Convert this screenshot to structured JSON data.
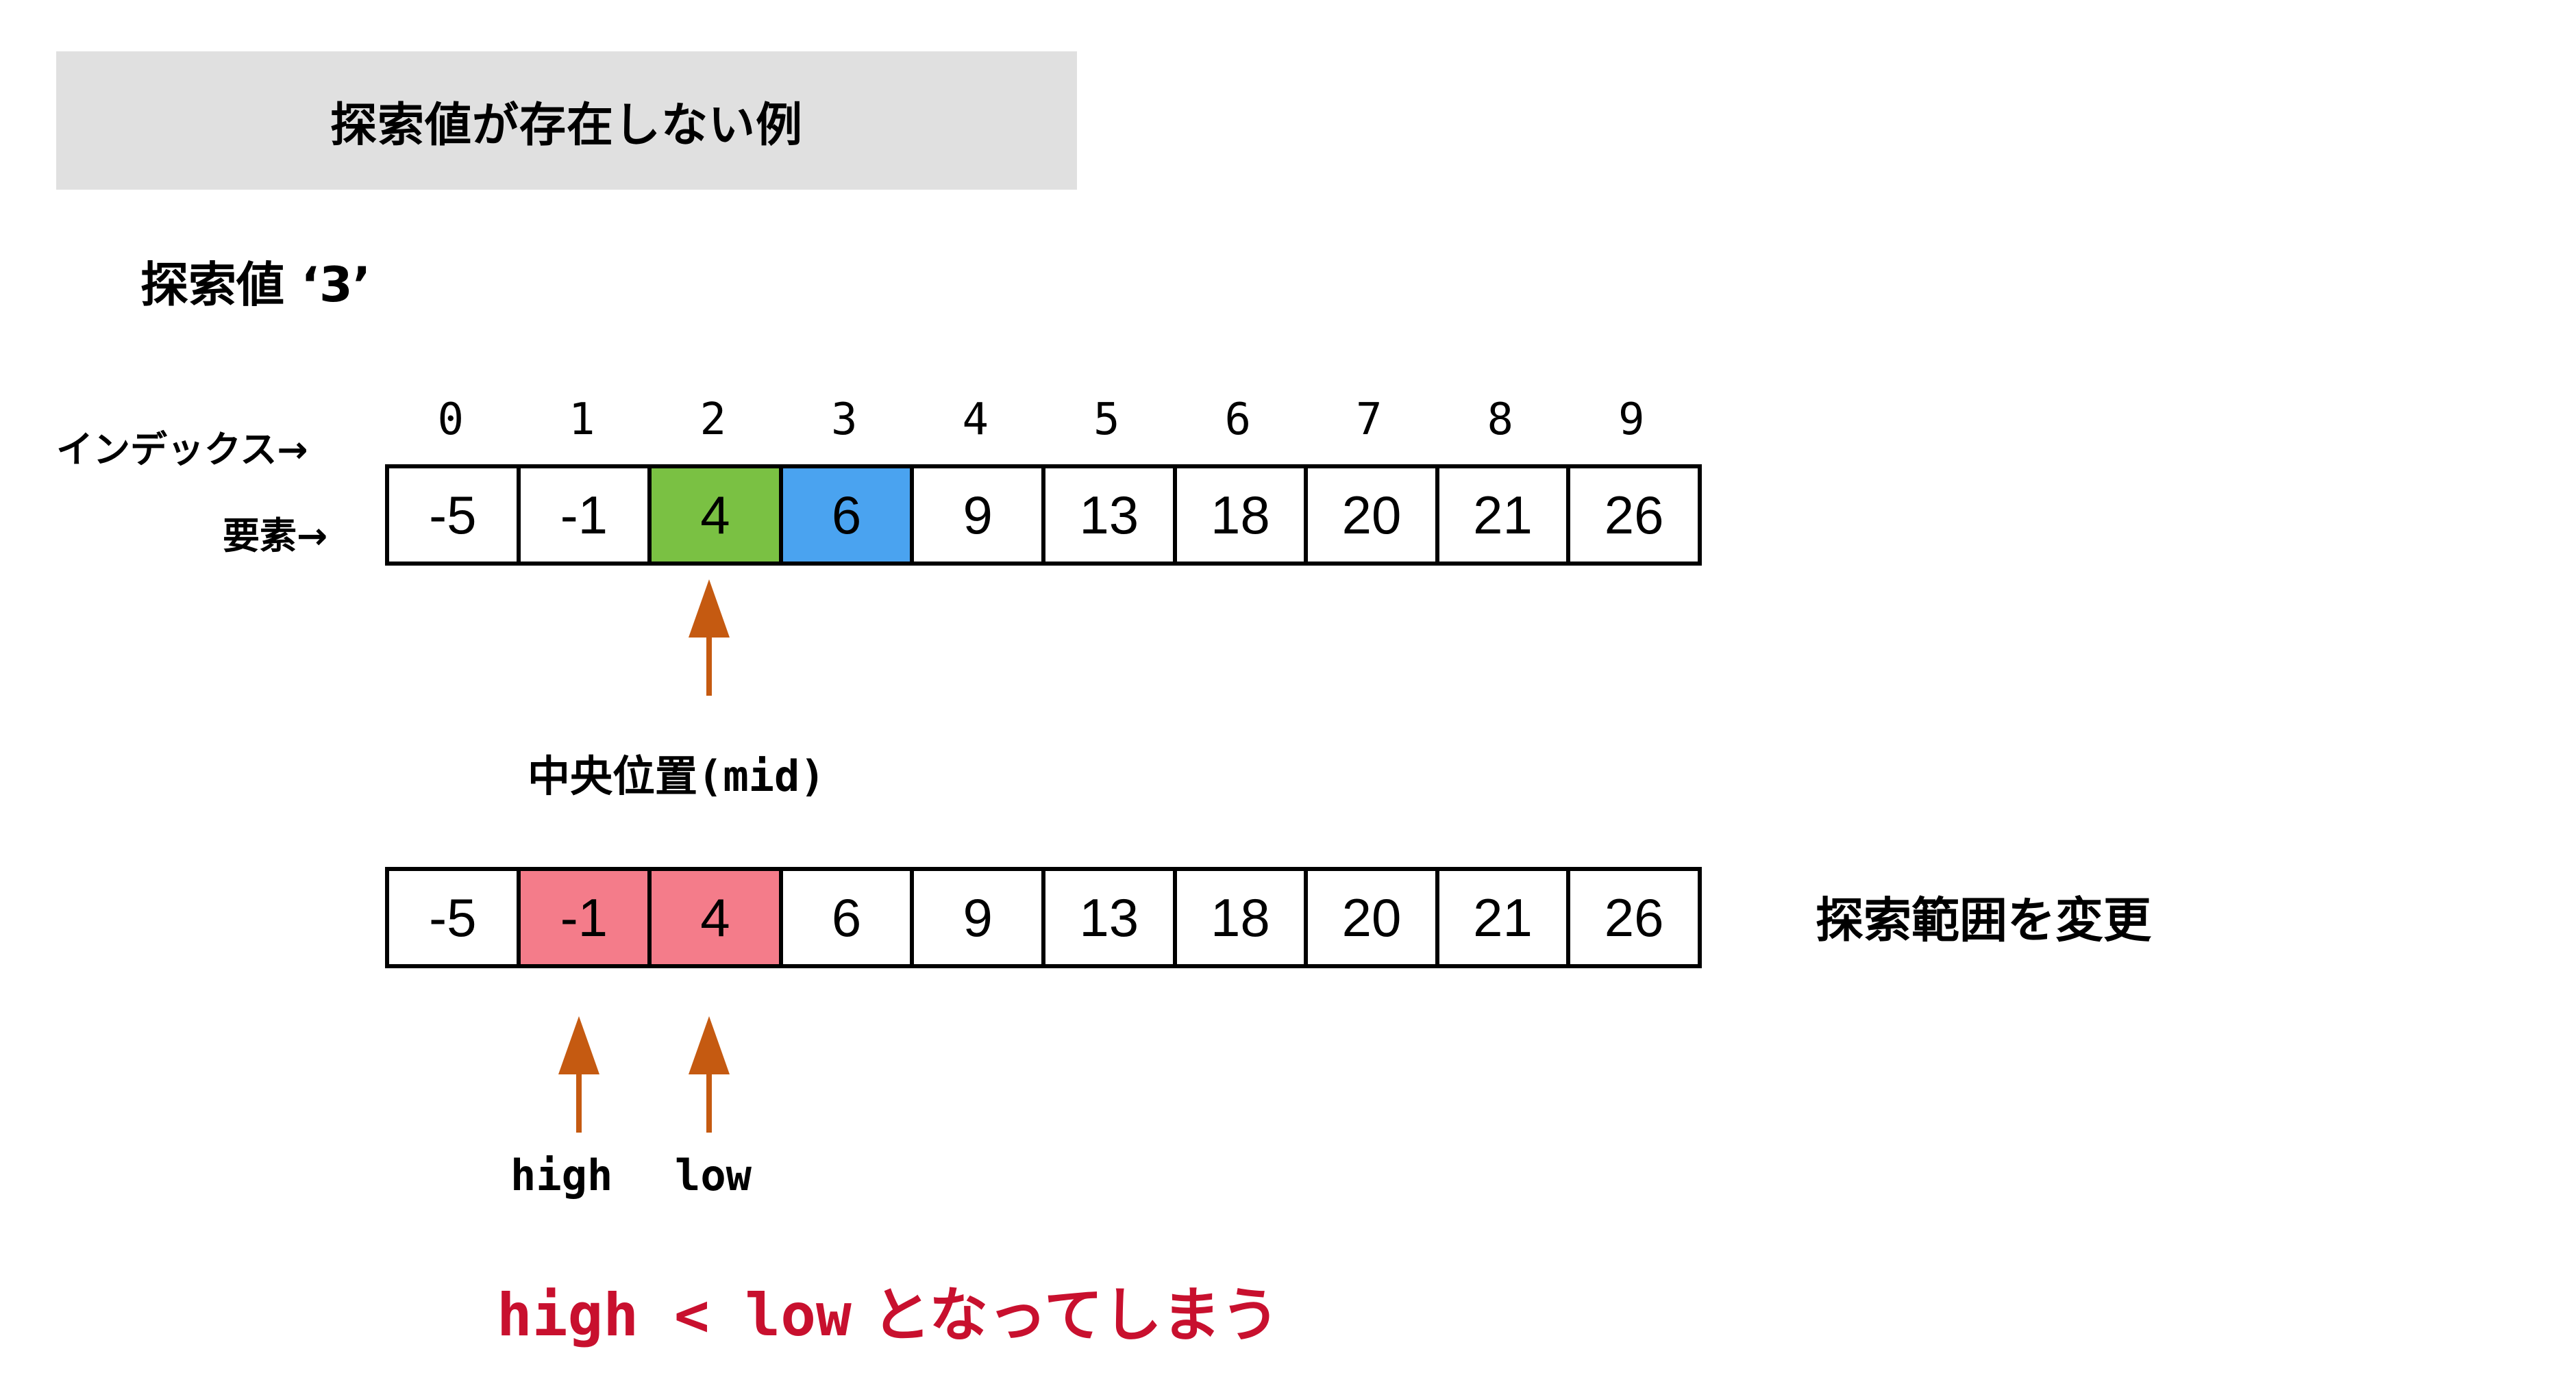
{
  "title": "探索値が存在しない例",
  "search_value_label": "探索値 ‘3’",
  "labels": {
    "index": "インデックス→",
    "element": "要素→"
  },
  "indices": [
    "0",
    "1",
    "2",
    "3",
    "4",
    "5",
    "6",
    "7",
    "8",
    "9"
  ],
  "array_before": {
    "elements": [
      "-5",
      "-1",
      "4",
      "6",
      "9",
      "13",
      "18",
      "20",
      "21",
      "26"
    ],
    "mid_index": 2,
    "target_index": 3
  },
  "array_after": {
    "elements": [
      "-5",
      "-1",
      "4",
      "6",
      "9",
      "13",
      "18",
      "20",
      "21",
      "26"
    ],
    "highlighted_indices": [
      1,
      2
    ]
  },
  "mid_label": {
    "jp": "中央位置",
    "code": "(mid)"
  },
  "pointers": {
    "high": "high",
    "low": "low"
  },
  "change_label": "探索範囲を変更",
  "conclusion": {
    "code": "high < low",
    "jp": "となってしまう"
  },
  "colors": {
    "mid": "#7ac143",
    "target": "#4aa3f0",
    "range": "#f47c8a",
    "arrow": "#c55a11",
    "conclusion": "#c8102e",
    "title_bg": "#e0e0e0"
  }
}
